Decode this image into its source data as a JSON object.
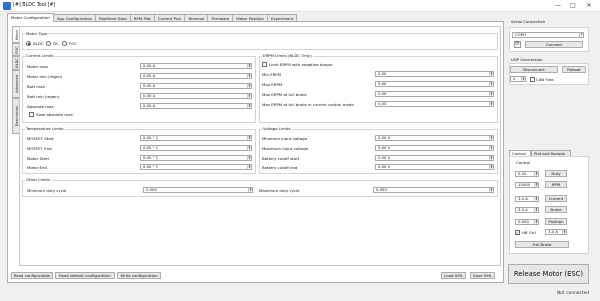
{
  "window": {
    "title": "[#] BLDC Tool [#]",
    "minimize": "—",
    "maximize": "□",
    "close": "✕"
  },
  "main_tabs": [
    "Motor Configuration",
    "App Configuration",
    "Realtime Data",
    "RPM Plot",
    "Current Plot",
    "Terminal",
    "Firmware",
    "Motor Position",
    "Experiment"
  ],
  "side_tabs": [
    "Motor",
    "FOC",
    "BLDC",
    "Advanced",
    "Description"
  ],
  "motor_type": {
    "title": "Motor Type",
    "options": [
      "BLDC",
      "DC",
      "FOC"
    ],
    "selected": "BLDC"
  },
  "current_limits": {
    "title": "Current Limits",
    "rows": [
      {
        "label": "Motor max",
        "value": "0.00 A"
      },
      {
        "label": "Motor min (regen)",
        "value": "0.00 A"
      },
      {
        "label": "Batt max",
        "value": "0.00 A"
      },
      {
        "label": "Batt min (regen)",
        "value": "0.00 A"
      },
      {
        "label": "Absolute max",
        "value": "0.00 A"
      }
    ],
    "slow_abs_label": "Slow absolute max"
  },
  "erpm_limits": {
    "title": "ERPM Limits (BLDC Only)",
    "negative_torque_label": "Limit ERPM with negative torque",
    "rows": [
      {
        "label": "Min ERPM",
        "value": "0.00"
      },
      {
        "label": "Max ERPM",
        "value": "0.00"
      },
      {
        "label": "Max ERPM at full brake",
        "value": "0.00"
      },
      {
        "label": "Max ERPM at full brake in current control mode",
        "value": "0.00"
      }
    ]
  },
  "temperature_limits": {
    "title": "Temperature Limits",
    "rows": [
      {
        "label": "MOSFET Start",
        "value": "0.00 ° C"
      },
      {
        "label": "MOSFET End",
        "value": "0.00 ° C"
      },
      {
        "label": "Motor Start",
        "value": "0.00 ° C"
      },
      {
        "label": "Motor End",
        "value": "0.00 ° C"
      }
    ]
  },
  "voltage_limits": {
    "title": "Voltage Limits",
    "rows": [
      {
        "label": "Minimum input voltage",
        "value": "0.00 V"
      },
      {
        "label": "Maximum input voltage",
        "value": "0.00 V"
      },
      {
        "label": "Battery cutoff start",
        "value": "0.00 V"
      },
      {
        "label": "Battery cutoff end",
        "value": "0.00 V"
      }
    ]
  },
  "other_limits": {
    "title": "Other Limits",
    "min_duty_label": "Minimum duty cycle",
    "min_duty_value": "0.000",
    "max_duty_label": "Maximum duty cycle",
    "max_duty_value": "0.950"
  },
  "bottom_buttons": {
    "read": "Read configuration",
    "read_default": "Read default configuration",
    "write": "Write configuration",
    "load_xml": "Load XML",
    "save_xml": "Save XML"
  },
  "serial": {
    "title": "Serial Connection",
    "port": "COM1",
    "connect": "Connect"
  },
  "udp": {
    "title": "UDP Connection",
    "disconnect": "Disconnect",
    "reboot": "Reboot",
    "port_value": "0",
    "can_fwd_label": "CAN Fwd"
  },
  "control": {
    "tabs": [
      "Control",
      "Plot and Sample"
    ],
    "title": "Control",
    "rows": [
      {
        "value": "0.20",
        "button": "Duty"
      },
      {
        "value": "15000",
        "button": "RPM"
      },
      {
        "value": "3.0 A",
        "button": "Current"
      },
      {
        "value": "3.0 A",
        "button": "Brake"
      },
      {
        "value": "0.000",
        "button": "Position"
      }
    ],
    "hb_label": "HB Ctrl",
    "hb_value": "3.0 A",
    "full_brake": "Full Brake"
  },
  "release_button": "Release Motor (ESC)",
  "status": "Not connected"
}
